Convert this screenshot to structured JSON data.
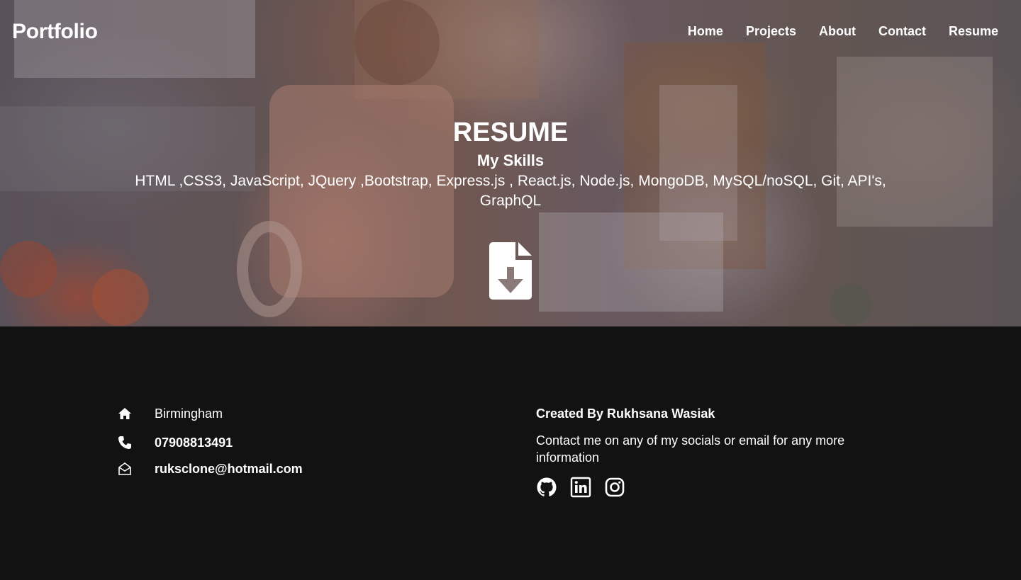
{
  "nav": {
    "brand": "Portfolio",
    "links": [
      "Home",
      "Projects",
      "About",
      "Contact",
      "Resume"
    ]
  },
  "hero": {
    "title": "RESUME",
    "subtitle": "My Skills",
    "skills": "HTML ,CSS3, JavaScript, JQuery ,Bootstrap, Express.js , React.js, Node.js, MongoDB, MySQL/noSQL, Git, API's, GraphQL",
    "download_icon": "file-download-icon"
  },
  "footer": {
    "location": "Birmingham",
    "phone": "07908813491",
    "email": "ruksclone@hotmail.com",
    "credit": "Created By Rukhsana Wasiak",
    "cta": "Contact me on any of my socials or email for any more information",
    "socials": [
      "github-icon",
      "linkedin-icon",
      "instagram-icon"
    ]
  },
  "colors": {
    "footer_bg": "#121212",
    "text": "#ffffff"
  }
}
